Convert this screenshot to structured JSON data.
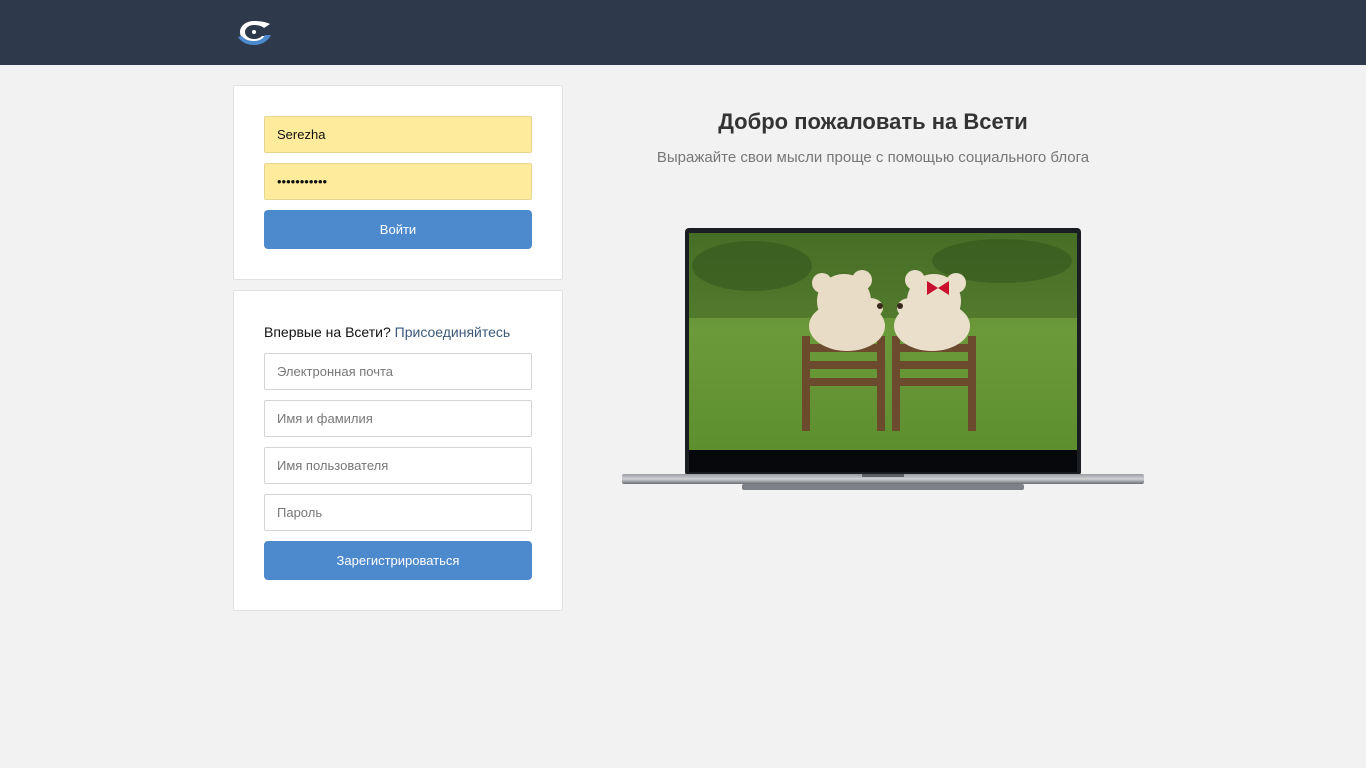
{
  "header": {
    "logo": "vseti-logo-icon"
  },
  "login": {
    "username_value": "Serezha",
    "password_value": "•••••••••••",
    "submit_label": "Войти"
  },
  "signup": {
    "prompt": "Впервые на Всети?",
    "join_link": "Присоединяйтесь",
    "email_placeholder": "Электронная почта",
    "fullname_placeholder": "Имя и фамилия",
    "username_placeholder": "Имя пользователя",
    "password_placeholder": "Пароль",
    "submit_label": "Зарегистрироваться"
  },
  "welcome": {
    "title": "Добро пожаловать на Всети",
    "subtitle": "Выражайте свои мысли проще с помощью социального блога"
  },
  "hero": {
    "image": "laptop-with-teddy-bears-illustration"
  },
  "colors": {
    "header_bg": "#2e3a4b",
    "accent": "#4d8acd",
    "autofill": "#feeb9c",
    "page_bg": "#f2f2f2"
  }
}
